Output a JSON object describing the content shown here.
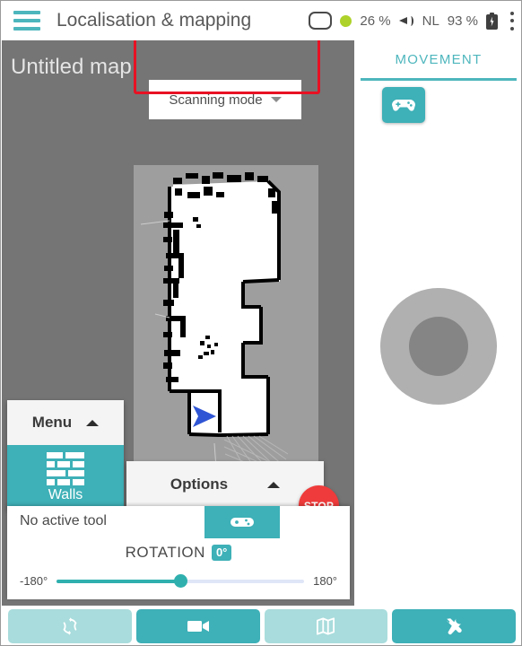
{
  "topbar": {
    "menu_icon": "hamburger-icon",
    "title": "Localisation & mapping",
    "status": {
      "screen_icon": "screen-icon",
      "connection_dot": "green-status-dot",
      "cpu_percent": "26 %",
      "volume_icon": "speaker-icon",
      "language": "NL",
      "battery_percent": "93 %",
      "battery_icon": "battery-charging-icon",
      "overflow_icon": "kebab-menu-icon"
    },
    "colors": {
      "accent_teal": "#4db6bd",
      "green": "#aed229",
      "text": "#595959"
    }
  },
  "stage": {
    "map_title": "Untitled map",
    "mode_select": {
      "label": "Scanning mode",
      "caret_icon": "chevron-down-icon",
      "highlight_color": "#e81123"
    },
    "background_color": "#757575",
    "map": {
      "name": "occupancy-grid-map",
      "free_color": "#ffffff",
      "occupied_color": "#000000",
      "unknown_color": "#9e9e9e",
      "robot_marker": "blue-arrow-robot-pose",
      "robot_color": "#2f55d4"
    }
  },
  "menu_panel": {
    "header_label": "Menu",
    "header_caret_icon": "chevron-up-icon",
    "tools": [
      {
        "label": "Walls",
        "icon": "brick-wall-icon",
        "active": true
      }
    ]
  },
  "options_panel": {
    "label": "Options",
    "caret_icon": "chevron-up-icon"
  },
  "stop_button": {
    "label": "STOP",
    "color": "#ef3b3b"
  },
  "tool_panel": {
    "active_tool_label": "No active tool",
    "gamepad_tab_icon": "gamepad-icon",
    "rotation": {
      "label": "ROTATION",
      "value": "0°",
      "min_label": "-180°",
      "max_label": "180°",
      "min": -180,
      "max": 180,
      "current": 0,
      "fill_color": "#2fb0ae",
      "track_color": "#dfe6f7"
    }
  },
  "right_panel": {
    "tab_label": "MOVEMENT",
    "tab_color": "#4db6bd",
    "gamepad_button_icon": "gamepad-icon",
    "joystick": {
      "name": "virtual-joystick",
      "outer_color": "#b0b0b0",
      "knob_color": "#858585"
    }
  },
  "bottom_nav": {
    "items": [
      {
        "icon": "sync-icon",
        "state": "inactive"
      },
      {
        "icon": "video-camera-icon",
        "state": "active"
      },
      {
        "icon": "map-icon",
        "state": "inactive"
      },
      {
        "icon": "tools-icon",
        "state": "active"
      }
    ],
    "active_color": "#3eb0b7",
    "inactive_color": "#a9dcdc"
  }
}
